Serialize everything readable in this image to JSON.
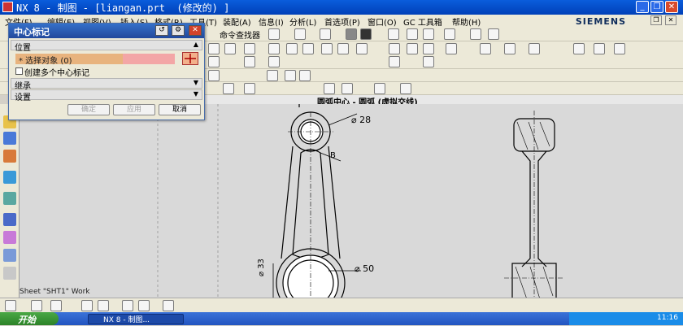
{
  "window": {
    "title": "NX 8 - 制图 - [liangan.prt  (修改的) ]",
    "brand": "SIEMENS"
  },
  "menu": {
    "items": [
      "文件(F)",
      "编辑(E)",
      "视图(V)",
      "插入(S)",
      "格式(R)",
      "工具(T)",
      "装配(A)",
      "信息(I)",
      "分析(L)",
      "首选项(P)",
      "窗口(O)",
      "GC 工具箱",
      "帮助(H)"
    ]
  },
  "toolbar": {
    "command_finder": "命令查找器"
  },
  "view": {
    "title": "圆弧中心 - 圆弧 (虚拟交线)"
  },
  "dialog": {
    "title": "中心标记",
    "section_position": "位置",
    "select_object": "* 选择对象 (0)",
    "create_multiple": "创建多个中心标记",
    "section_inherit": "继承",
    "section_settings": "设置",
    "btn_ok": "确定",
    "btn_apply": "应用",
    "btn_cancel": "取消"
  },
  "drawing": {
    "dim_small_hole": "⌀ 28",
    "dim_big_hole": "⌀ 50",
    "dim_vertical": "⌀ 33",
    "label_B": "B"
  },
  "status": {
    "sheet": "Sheet \"SHT1\" Work"
  },
  "taskbar": {
    "start": "开始",
    "task": "NX 8 - 制图...",
    "clock": "11:16"
  },
  "colors": {
    "titlebar": "#0a5ddc",
    "dialog_title": "#22499c",
    "select_field": "#e8b37e",
    "canvas": "#d9d9d9"
  }
}
